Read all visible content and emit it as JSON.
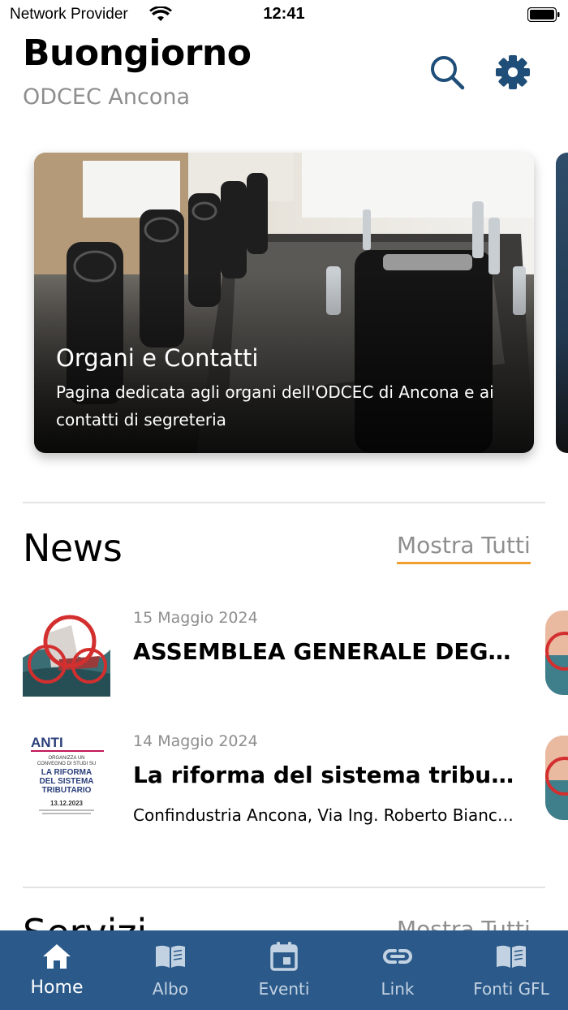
{
  "status_bar": {
    "carrier": "Network Provider",
    "time": "12:41",
    "icons": [
      "wifi-icon",
      "battery-icon"
    ]
  },
  "header": {
    "greeting": "Buongiorno",
    "subtitle": "ODCEC Ancona",
    "actions": [
      {
        "icon": "search-icon",
        "color": "#1f4e79"
      },
      {
        "icon": "gear-icon",
        "color": "#1f4e79"
      }
    ]
  },
  "carousel": {
    "cards": [
      {
        "title": "Organi e Contatti",
        "description": "Pagina dedicata agli organi dell'ODCEC di Ancona e ai contatti di segreteria",
        "image": "conference-room-photo"
      }
    ]
  },
  "news": {
    "title": "News",
    "show_all": "Mostra Tutti",
    "accent_color": "#f0a030",
    "items": [
      {
        "date": "15 Maggio 2024",
        "title": "ASSEMBLEA GENERALE DEGLI ISCRITTI",
        "subtitle": "",
        "thumbnail": "sailing-boat-thumbnail"
      },
      {
        "date": "14 Maggio 2024",
        "title": "La riforma del sistema tributario",
        "subtitle": "Confindustria Ancona, Via Ing. Roberto Bianchi, snc",
        "thumbnail": "anti-poster-thumbnail",
        "poster": {
          "brand": "ANTI",
          "line1": "ORGANIZZA UN",
          "line2": "CONVEGNO DI STUDI SU",
          "headline": [
            "LA RIFORMA",
            "DEL SISTEMA",
            "TRIBUTARIO"
          ],
          "date": "13.12.2023"
        }
      }
    ]
  },
  "servizi": {
    "title": "Servizi",
    "show_all": "Mostra Tutti"
  },
  "tab_bar": {
    "background": "#2b5a8a",
    "tabs": [
      {
        "label": "Home",
        "icon": "home-icon",
        "active": true
      },
      {
        "label": "Albo",
        "icon": "book-icon",
        "active": false
      },
      {
        "label": "Eventi",
        "icon": "calendar-icon",
        "active": false
      },
      {
        "label": "Link",
        "icon": "link-icon",
        "active": false
      },
      {
        "label": "Fonti GFL",
        "icon": "book-icon",
        "active": false
      }
    ]
  }
}
